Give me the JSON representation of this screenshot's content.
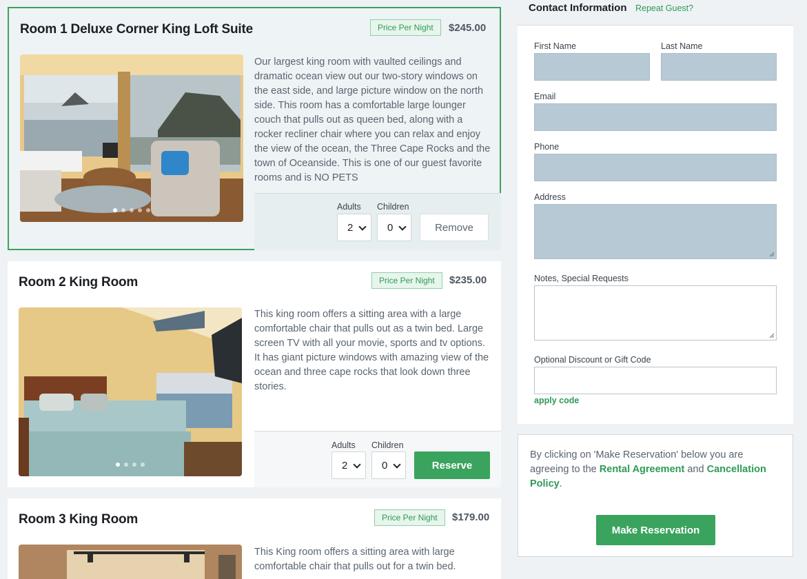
{
  "rooms": [
    {
      "title": "Room 1 Deluxe Corner King Loft Suite",
      "price_badge": "Price Per Night",
      "price": "$245.00",
      "description": "Our largest king room with vaulted ceilings and dramatic ocean view out our two-story windows on the east side, and large picture window on the north side. This room has a comfortable large lounger couch that pulls out as queen bed, along with a rocker recliner chair where you can relax and enjoy the view of the ocean, the Three Cape Rocks and the town of Oceanside. This is one of our guest favorite rooms and is NO PETS",
      "adults_label": "Adults",
      "children_label": "Children",
      "adults_value": "2",
      "children_value": "0",
      "action_label": "Remove",
      "selected": true
    },
    {
      "title": "Room 2 King Room",
      "price_badge": "Price Per Night",
      "price": "$235.00",
      "description": "This king room offers a sitting area with a large comfortable chair that pulls out as a twin bed. Large screen TV with all your movie, sports and tv options. It has giant picture windows with amazing view of the ocean and three cape rocks that look down three stories.",
      "adults_label": "Adults",
      "children_label": "Children",
      "adults_value": "2",
      "children_value": "0",
      "action_label": "Reserve",
      "selected": false
    },
    {
      "title": "Room 3 King Room",
      "price_badge": "Price Per Night",
      "price": "$179.00",
      "description": "This King room offers a sitting area with large comfortable chair that pulls out for a twin bed.",
      "selected": false
    }
  ],
  "contact": {
    "title": "Contact Information",
    "repeat_link": "Repeat Guest?",
    "first_name_label": "First Name",
    "last_name_label": "Last Name",
    "email_label": "Email",
    "phone_label": "Phone",
    "address_label": "Address",
    "notes_label": "Notes, Special Requests",
    "discount_label": "Optional Discount or Gift Code",
    "apply_link": "apply code"
  },
  "agreement": {
    "text_before": "By clicking on 'Make Reservation' below you are agreeing to the ",
    "rental_link": "Rental Agreement",
    "text_and": " and ",
    "cancel_link": "Cancellation Policy",
    "text_end": ".",
    "button_label": "Make Reservation"
  },
  "colors": {
    "accent_green": "#3aa35e",
    "field_fill": "#b7c9d4",
    "page_bg": "#eef2f5"
  }
}
